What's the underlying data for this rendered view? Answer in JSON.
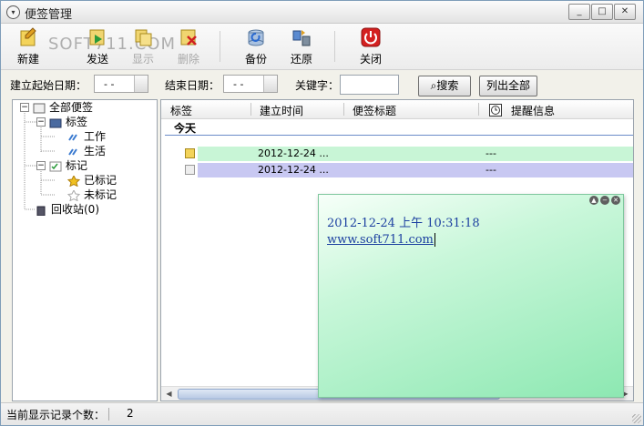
{
  "window": {
    "title": "便签管理",
    "controls": [
      "_",
      "□",
      "✕"
    ]
  },
  "watermark": "SOFT711.COM",
  "toolbar": {
    "items": [
      {
        "label": "新建",
        "icon": "new-note-icon"
      },
      {
        "label": "发送",
        "icon": "send-icon"
      },
      {
        "label": "显示",
        "icon": "show-icon"
      },
      {
        "label": "删除",
        "icon": "delete-icon"
      },
      {
        "label": "备份",
        "icon": "backup-icon"
      },
      {
        "label": "还原",
        "icon": "restore-icon"
      },
      {
        "label": "关闭",
        "icon": "power-icon"
      }
    ]
  },
  "filter": {
    "start_label": "建立起始日期：",
    "start_value": "- -",
    "end_label": "结束日期：",
    "end_value": "- -",
    "keyword_label": "关键字：",
    "keyword_value": "",
    "search_button": "搜索",
    "list_all_button": "列出全部"
  },
  "tree": {
    "root": "全部便签",
    "tags": "标签",
    "tag_work": "工作",
    "tag_life": "生活",
    "marks": "标记",
    "marked": "已标记",
    "unmarked": "未标记",
    "recycle": "回收站(0)"
  },
  "list": {
    "columns": [
      "标签",
      "建立时间",
      "便签标题",
      "提醒信息"
    ],
    "group_today": "今天",
    "rows": [
      {
        "time": "2012-12-24 ...",
        "remind": "---",
        "color": "#c8f5d6"
      },
      {
        "time": "2012-12-24 ...",
        "remind": "---",
        "color": "#c8c8f2"
      }
    ]
  },
  "note": {
    "line1": "2012-12-24 上午 10:31:18",
    "line2": "www.soft711.com"
  },
  "status": {
    "label": "当前显示记录个数：",
    "count": "2"
  }
}
